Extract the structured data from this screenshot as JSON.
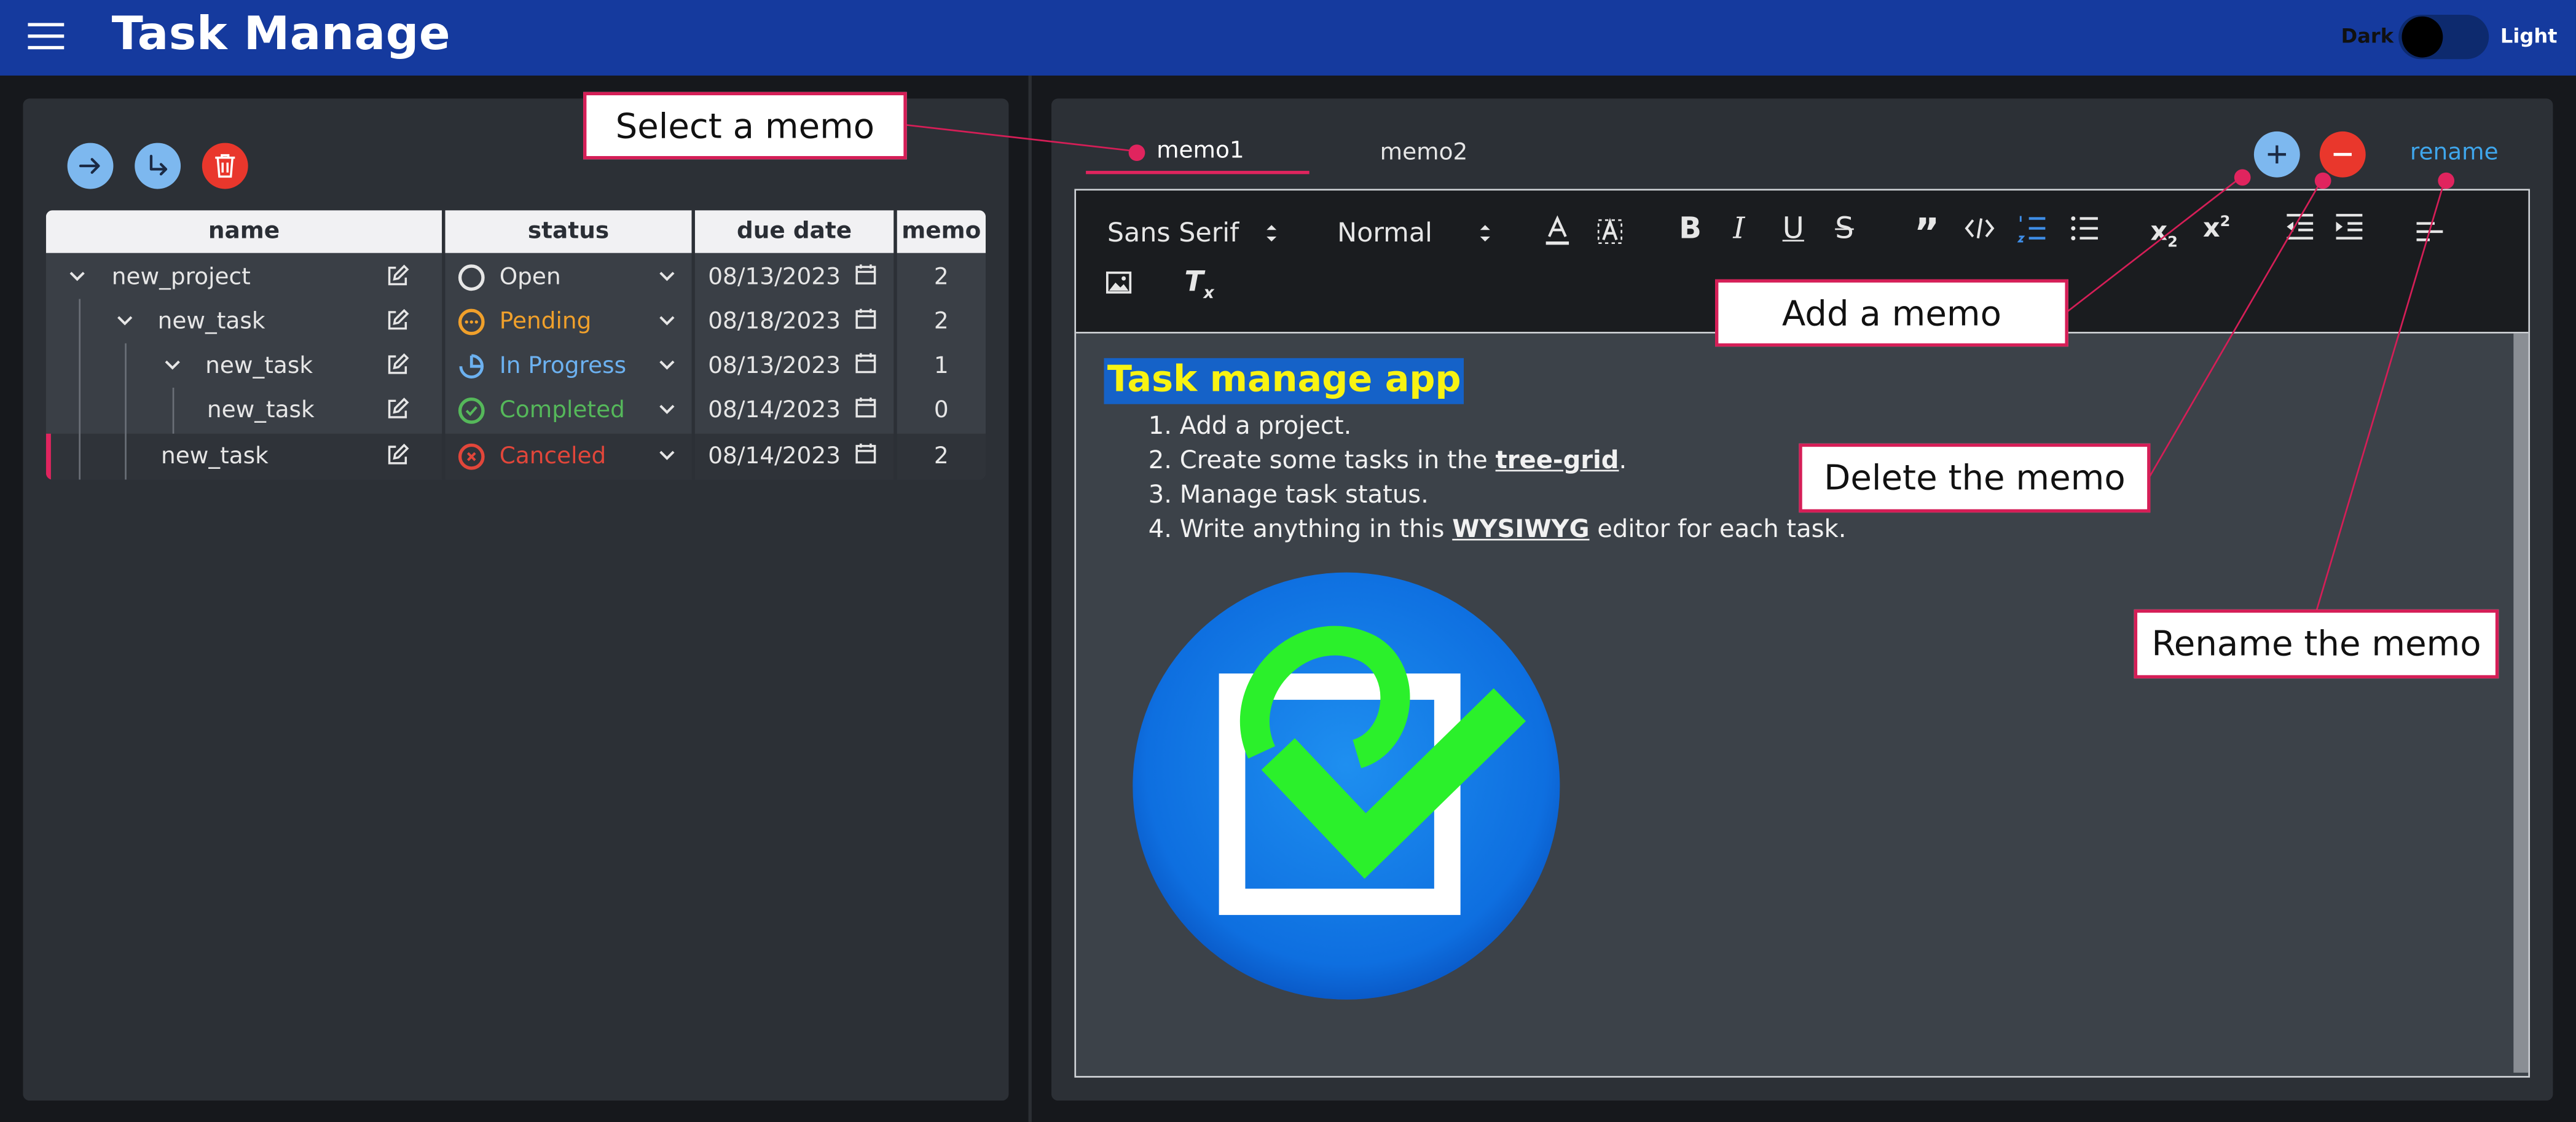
{
  "header": {
    "title": "Task Manage",
    "theme_dark": "Dark",
    "theme_light": "Light"
  },
  "grid": {
    "columns": [
      "name",
      "status",
      "due date",
      "memo"
    ],
    "rows": [
      {
        "name": "new_project",
        "status": "Open",
        "due": "08/13/2023",
        "memo": "2",
        "status_color": "#e6e6e6"
      },
      {
        "name": "new_task",
        "status": "Pending",
        "due": "08/18/2023",
        "memo": "2",
        "status_color": "#f0a02b"
      },
      {
        "name": "new_task",
        "status": "In Progress",
        "due": "08/13/2023",
        "memo": "1",
        "status_color": "#6cb1f0"
      },
      {
        "name": "new_task",
        "status": "Completed",
        "due": "08/14/2023",
        "memo": "0",
        "status_color": "#55b85a"
      },
      {
        "name": "new_task",
        "status": "Canceled",
        "due": "08/14/2023",
        "memo": "2",
        "status_color": "#e2463a"
      }
    ]
  },
  "memo": {
    "tabs": [
      "memo1",
      "memo2"
    ],
    "rename_label": "rename"
  },
  "toolbar": {
    "font": "Sans Serif",
    "size": "Normal"
  },
  "content": {
    "heading": "Task manage app",
    "items": [
      {
        "pre": "Add a project.",
        "bold": "",
        "post": ""
      },
      {
        "pre": "Create some tasks in the ",
        "bold": "tree-grid",
        "post": "."
      },
      {
        "pre": "Manage task status.",
        "bold": "",
        "post": ""
      },
      {
        "pre": "Write anything in this ",
        "bold": "WYSIWYG",
        "post": " editor for each task."
      }
    ]
  },
  "callouts": {
    "select_memo": "Select a memo",
    "add_memo": "Add a memo",
    "delete_memo": "Delete the memo",
    "rename_memo": "Rename the memo"
  },
  "colors": {
    "header": "#153a9e",
    "callout_border": "#d51e57",
    "highlight_bg": "#1562c8",
    "highlight_text": "#f8f312"
  }
}
